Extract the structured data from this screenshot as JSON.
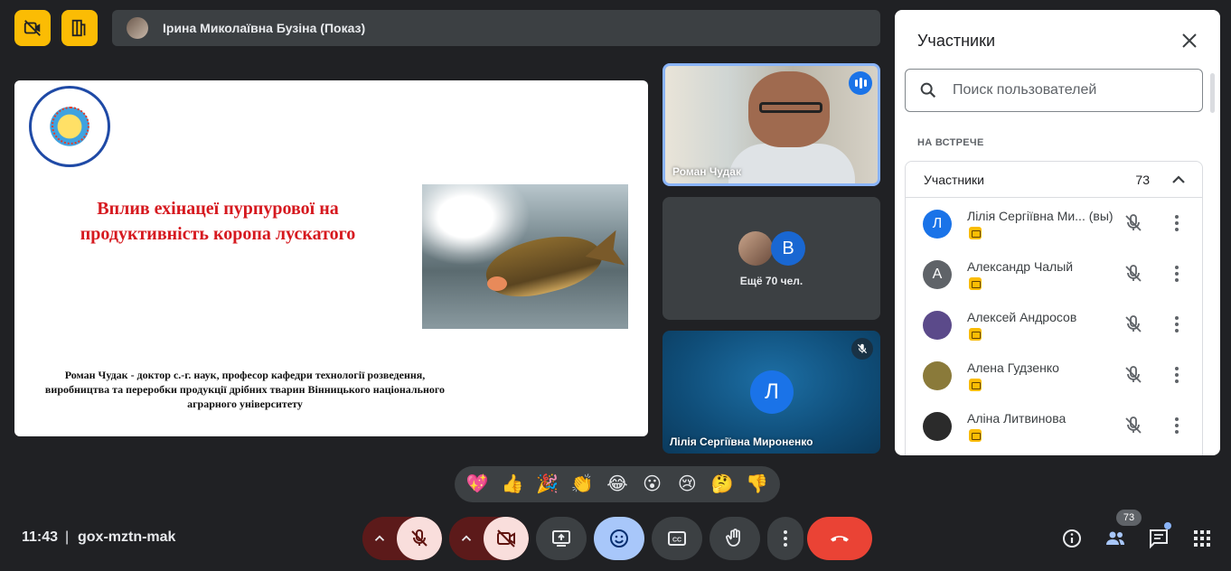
{
  "top": {
    "presenter_name": "Ірина Миколаївна Бузіна (Показ)",
    "icons": [
      "camera-off-layout-icon",
      "pin-layout-icon"
    ]
  },
  "slide": {
    "title": "Вплив ехінацеї пурпурової на продуктивність коропа лускатого",
    "author": "Роман Чудак - доктор с.-г. наук, професор кафедри технології розведення, виробництва та переробки продукції дрібних тварин Вінницького національного аграрного університету",
    "cursor": "˄"
  },
  "tiles": {
    "speaker": {
      "name": "Роман Чудак"
    },
    "more": {
      "avatar_letter": "В",
      "label": "Ещё 70 чел."
    },
    "self": {
      "avatar_letter": "Л",
      "name": "Лілія Сергіївна Мироненко"
    }
  },
  "panel": {
    "title": "Участники",
    "search_placeholder": "Поиск пользователей",
    "section": "НА ВСТРЕЧЕ",
    "group_title": "Участники",
    "group_count": "73",
    "participants": [
      {
        "name": "Лілія Сергіївна Ми...  (вы)",
        "avatar": "Л",
        "color": "#1a73e8"
      },
      {
        "name": "Александр Чалый",
        "avatar": "А",
        "color": "#5f6368"
      },
      {
        "name": "Алексей Андросов",
        "avatar": "",
        "color": "#5b4a8a"
      },
      {
        "name": "Алена Гудзенко",
        "avatar": "",
        "color": "#8a7a3a"
      },
      {
        "name": "Аліна Литвинова",
        "avatar": "",
        "color": "#2b2b2b"
      }
    ]
  },
  "reactions": [
    "💖",
    "👍",
    "🎉",
    "👏",
    "😂",
    "😮",
    "😢",
    "🤔",
    "👎"
  ],
  "bottom": {
    "time": "11:43",
    "separator": "|",
    "meeting_code": "gox-mztn-mak",
    "people_count": "73"
  },
  "colors": {
    "accent": "#8ab4f8",
    "leave": "#ea4335",
    "mute_bg": "#f9dedc",
    "yellow": "#fbbc04"
  }
}
